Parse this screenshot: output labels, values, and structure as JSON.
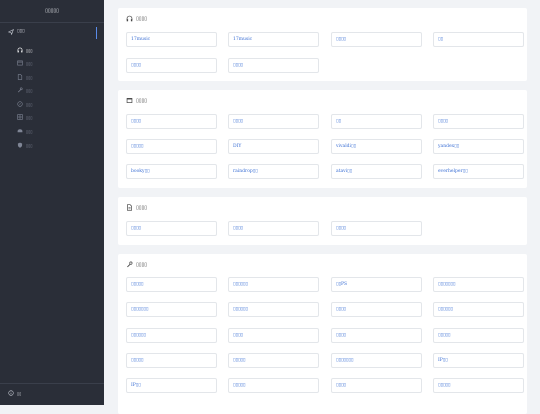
{
  "sidebar": {
    "brand": "▯▯▯▯▯",
    "nav_head": {
      "label": "▯▯▯",
      "icon": "send-icon"
    },
    "items": [
      {
        "label": "▯▯▯",
        "icon": "headphones-icon",
        "active": true
      },
      {
        "label": "▯▯▯",
        "icon": "window-icon"
      },
      {
        "label": "▯▯▯",
        "icon": "file-icon"
      },
      {
        "label": "▯▯▯",
        "icon": "wrench-icon"
      },
      {
        "label": "▯▯▯",
        "icon": "compass-icon"
      },
      {
        "label": "▯▯▯",
        "icon": "grid-icon"
      },
      {
        "label": "▯▯▯",
        "icon": "drive-icon"
      },
      {
        "label": "▯▯▯",
        "icon": "shield-icon"
      }
    ],
    "footer": {
      "label": "▯▯",
      "icon": "info-icon"
    }
  },
  "sections": [
    {
      "title": "▯▯▯▯",
      "icon": "headphones-icon",
      "tiles": [
        "17music",
        "17music",
        "▯▯▯▯",
        "▯▯",
        "▯▯▯▯",
        "▯▯▯▯"
      ]
    },
    {
      "title": "▯▯▯▯",
      "icon": "window-icon",
      "tiles": [
        "▯▯▯▯",
        "▯▯▯▯",
        "▯▯",
        "▯▯▯▯",
        "▯▯▯▯▯",
        "DIY",
        "vivaldi▯▯",
        "yandex▯▯",
        "booky▯▯",
        "raindrop▯▯",
        "atavi▯▯",
        "everhelper▯▯"
      ]
    },
    {
      "title": "▯▯▯▯",
      "icon": "file-icon",
      "tiles": [
        "▯▯▯▯",
        "▯▯▯▯",
        "▯▯▯▯"
      ]
    },
    {
      "title": "▯▯▯▯",
      "icon": "wrench-icon",
      "tiles": [
        "▯▯▯▯▯",
        "▯▯▯▯▯▯",
        "▯▯PS",
        "▯▯▯▯▯▯▯",
        "▯▯▯▯▯▯▯",
        "▯▯▯▯▯▯",
        "▯▯▯▯",
        "▯▯▯▯▯▯",
        "▯▯▯▯▯▯",
        "▯▯▯▯",
        "▯▯▯▯",
        "▯▯▯▯▯",
        "▯▯▯▯▯",
        "▯▯▯▯▯",
        "▯▯▯▯▯▯▯",
        "IP▯▯",
        "IP▯▯",
        "▯▯▯▯▯",
        "▯▯▯▯",
        "▯▯▯▯▯"
      ]
    }
  ]
}
